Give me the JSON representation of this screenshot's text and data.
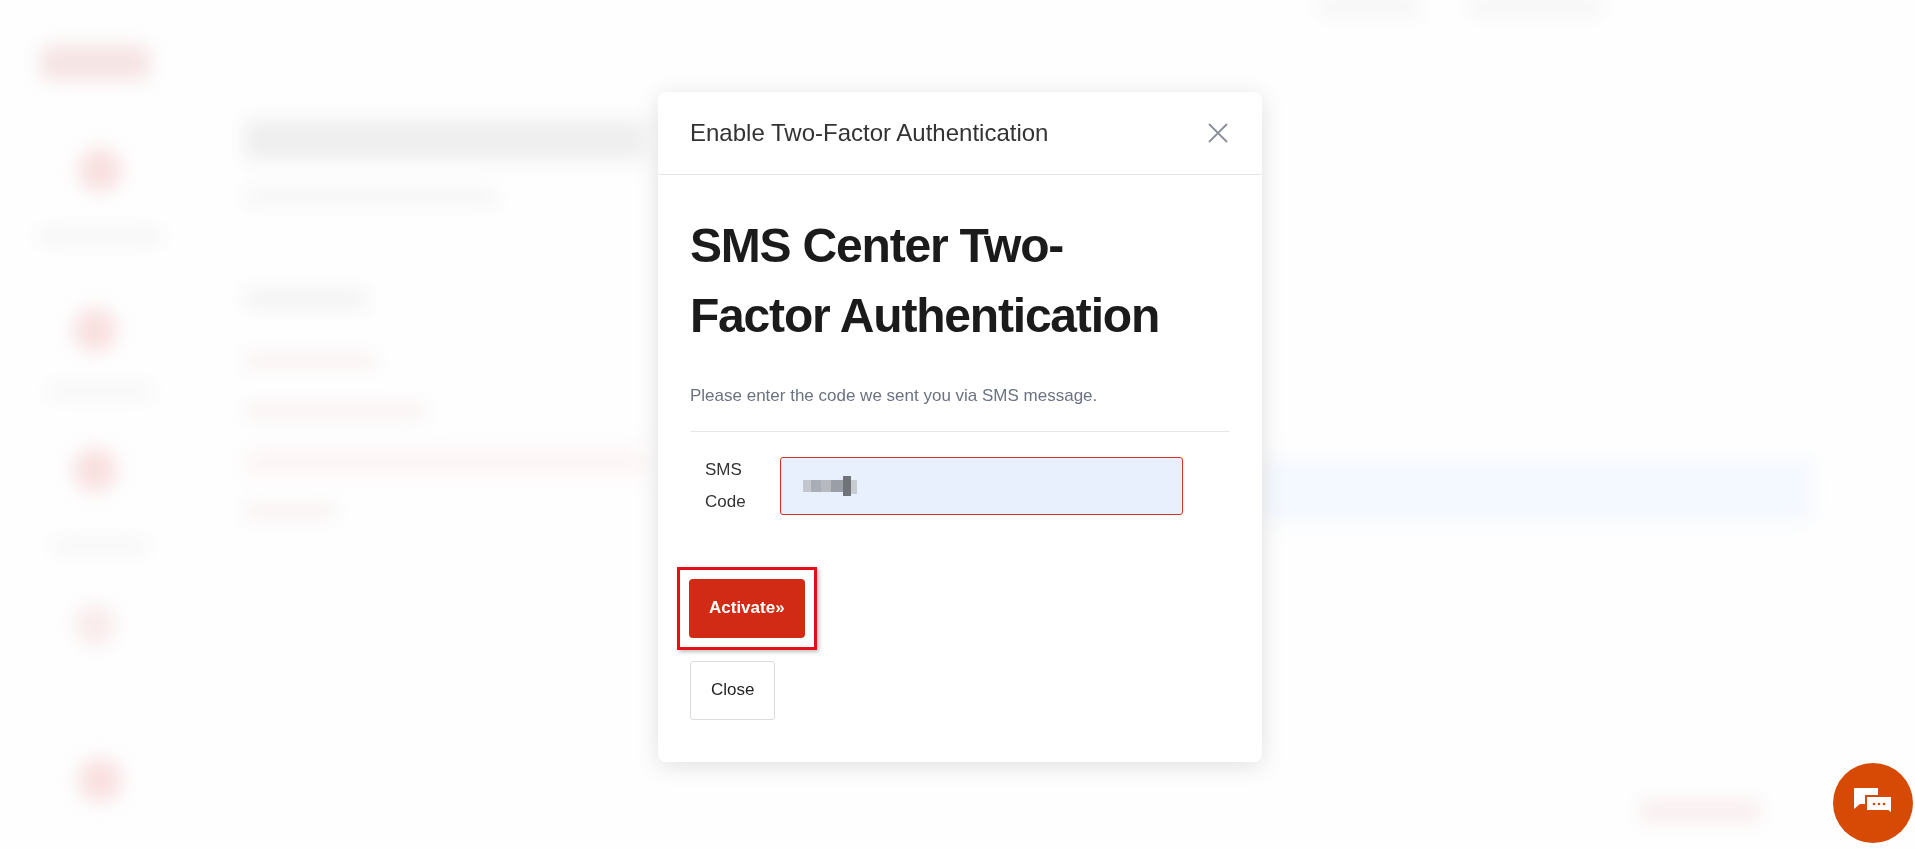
{
  "dialog": {
    "title": "Enable Two-Factor Authentication",
    "heading_lines": [
      "SMS Center Two-",
      "Factor Authentication"
    ],
    "description": "Please enter the code we sent you via SMS message.",
    "field": {
      "label_lines": [
        "SMS",
        "Code"
      ],
      "invalid": true
    },
    "buttons": [
      {
        "label": "Activate»",
        "kind": "primary",
        "highlighted": true
      },
      {
        "label": "Close",
        "kind": "secondary",
        "highlighted": false
      }
    ]
  }
}
